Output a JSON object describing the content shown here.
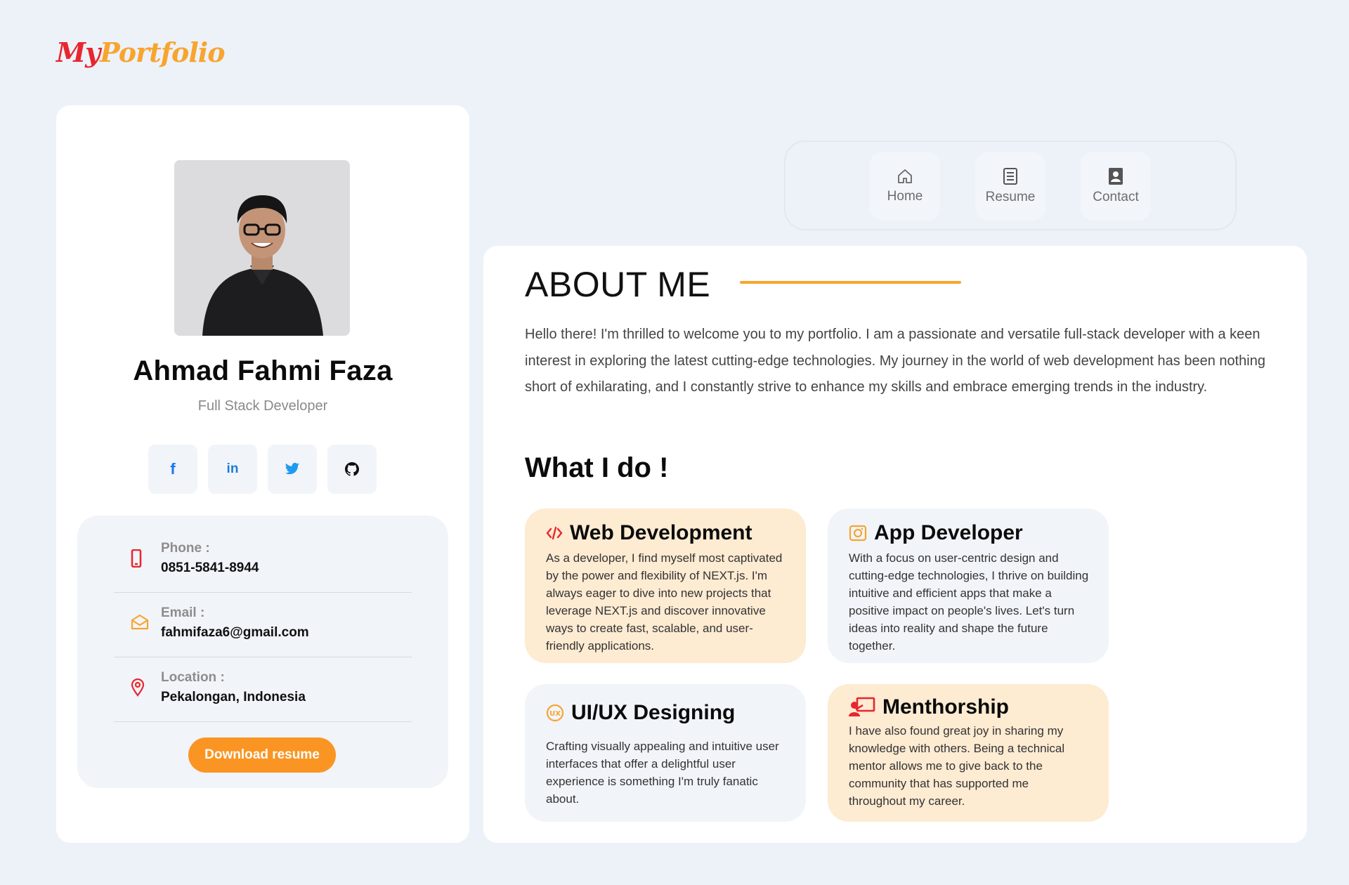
{
  "logo": {
    "part1": "My",
    "part2": "Portfolio"
  },
  "profile": {
    "name": "Ahmad Fahmi Faza",
    "role": "Full Stack Developer",
    "socials": [
      {
        "icon": "facebook-icon",
        "glyph": "f"
      },
      {
        "icon": "linkedin-icon",
        "glyph": "in"
      },
      {
        "icon": "twitter-icon",
        "glyph": ""
      },
      {
        "icon": "github-icon",
        "glyph": ""
      }
    ],
    "contacts": [
      {
        "label": "Phone :",
        "value": "0851-5841-8944",
        "icon": "phone-icon"
      },
      {
        "label": "Email :",
        "value": "fahmifaza6@gmail.com",
        "icon": "email-icon"
      },
      {
        "label": "Location :",
        "value": "Pekalongan, Indonesia",
        "icon": "location-icon"
      }
    ],
    "download_label": "Download resume"
  },
  "nav": [
    {
      "label": "Home",
      "icon": "home-icon"
    },
    {
      "label": "Resume",
      "icon": "document-icon"
    },
    {
      "label": "Contact",
      "icon": "contact-book-icon"
    }
  ],
  "about": {
    "title": "ABOUT ME",
    "text": "Hello there! I'm thrilled to welcome you to my portfolio. I am a passionate and versatile full-stack developer with a keen interest in exploring the latest cutting-edge technologies. My journey in the world of web development has been nothing short of exhilarating, and I constantly strive to enhance my skills and embrace emerging trends in the industry."
  },
  "whatido": {
    "title": "What I do !",
    "services": [
      {
        "title": "Web Development",
        "icon": "code-icon",
        "text": "As a developer, I find myself most captivated by the power and flexibility of NEXT.js. I'm always eager to dive into new projects that leverage NEXT.js and discover innovative ways to create fast, scalable, and user-friendly applications."
      },
      {
        "title": "App Developer",
        "icon": "app-icon",
        "text": "With a focus on user-centric design and cutting-edge technologies, I thrive on building intuitive and efficient apps that make a positive impact on people's lives. Let's turn ideas into reality and shape the future together."
      },
      {
        "title": "UI/UX Designing",
        "icon": "ux-icon",
        "text": "Crafting visually appealing and intuitive user interfaces that offer a delightful user experience is something I'm truly fanatic about."
      },
      {
        "title": "Menthorship",
        "icon": "mentor-icon",
        "text": "I have also found great joy in sharing my knowledge with others. Being a technical mentor allows me to give back to the community that has supported me throughout my career."
      }
    ]
  },
  "colors": {
    "accent": "#fa9523",
    "brand_red": "#e8262e",
    "background": "#edf2f9"
  }
}
